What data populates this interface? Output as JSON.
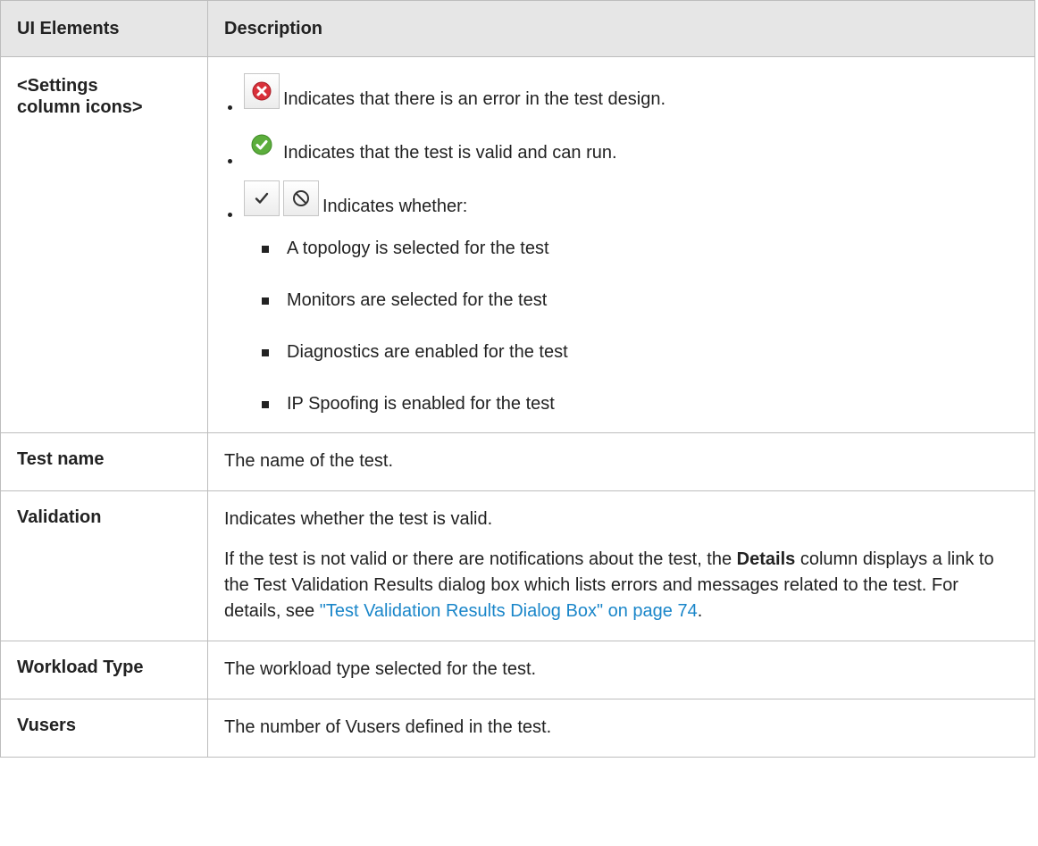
{
  "header": {
    "col1": "UI Elements",
    "col2": "Description"
  },
  "row_icons": {
    "label": "<Settings column icons>",
    "bullets": [
      {
        "icon": "error-icon",
        "text": "Indicates that there is an error in the test design."
      },
      {
        "icon": "valid-icon",
        "text": "Indicates that the test is valid and can run."
      },
      {
        "icon": "check-and-disabled-icons",
        "text": "Indicates whether:"
      }
    ],
    "sub_items": [
      "A topology is selected for the test",
      "Monitors are selected for the test",
      "Diagnostics are enabled for the test",
      "IP Spoofing is enabled for the test"
    ]
  },
  "row_testname": {
    "label": "Test name",
    "desc": "The name of the test."
  },
  "row_validation": {
    "label": "Validation",
    "desc1": "Indicates whether the test is valid.",
    "desc2_pre": "If the test is not valid or there are notifications about the test, the ",
    "desc2_bold": "Details",
    "desc2_mid": " column displays a link to the Test Validation Results dialog box which lists errors and messages related to the test. For details, see ",
    "desc2_link": "\"Test Validation Results Dialog Box\" on page 74",
    "desc2_end": "."
  },
  "row_workload": {
    "label": "Workload Type",
    "desc": "The workload type selected for the test."
  },
  "row_vusers": {
    "label": "Vusers",
    "desc": "The number of Vusers defined in the test."
  },
  "colors": {
    "header_bg": "#e6e6e6",
    "border": "#bdbdbd",
    "link": "#1a86c9",
    "error_red": "#d9303a",
    "valid_green": "#5cae3c"
  }
}
